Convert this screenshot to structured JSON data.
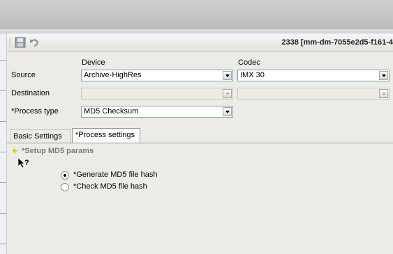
{
  "header": {
    "title": "2338 [mm-dm-7055e2d5-f161-4"
  },
  "toolbar": {
    "icons": [
      "save-icon",
      "undo-icon"
    ]
  },
  "form": {
    "column_device": "Device",
    "column_codec": "Codec",
    "source_label": "Source",
    "source_device": "Archive-HighRes",
    "source_codec": "IMX 30",
    "destination_label": "Destination",
    "destination_device": "",
    "destination_codec": "",
    "process_type_label": "*Process type",
    "process_type_value": "MD5 Checksum"
  },
  "tabs": [
    {
      "label": "Basic Settings",
      "active": false
    },
    {
      "label": "*Process settings",
      "active": true
    }
  ],
  "section": {
    "title": "*Setup MD5 params",
    "help_icon": "whats-this-icon",
    "options": [
      {
        "label": "*Generate MD5 file hash",
        "checked": true
      },
      {
        "label": "*Check MD5 file hash",
        "checked": false
      }
    ]
  }
}
